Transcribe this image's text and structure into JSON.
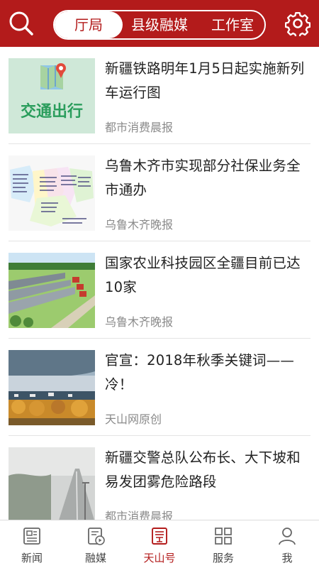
{
  "header": {
    "tabs": [
      {
        "label": "厅局"
      },
      {
        "label": "县级融媒"
      },
      {
        "label": "工作室"
      }
    ],
    "search_icon": "search-icon",
    "settings_icon": "gear-icon"
  },
  "colors": {
    "brand": "#b31b1b",
    "muted": "#8a8a8a"
  },
  "news": [
    {
      "title": "新疆铁路明年1月5日起实施新列车运行图",
      "source": "都市消费晨报",
      "thumb_text": "交通出行"
    },
    {
      "title": "乌鲁木齐市实现部分社保业务全市通办",
      "source": "乌鲁木齐晚报"
    },
    {
      "title": "国家农业科技园区全疆目前已达10家",
      "source": "乌鲁木齐晚报"
    },
    {
      "title": "官宣：2018年秋季关键词——冷！",
      "source": "天山网原创"
    },
    {
      "title": "新疆交警总队公布长、大下坡和易发团雾危险路段",
      "source": "都市消费晨报"
    }
  ],
  "tabbar": [
    {
      "label": "新闻",
      "icon": "newspaper-icon"
    },
    {
      "label": "融媒",
      "icon": "media-icon"
    },
    {
      "label": "天山号",
      "icon": "tianshan-icon"
    },
    {
      "label": "服务",
      "icon": "grid-icon"
    },
    {
      "label": "我",
      "icon": "user-icon"
    }
  ]
}
